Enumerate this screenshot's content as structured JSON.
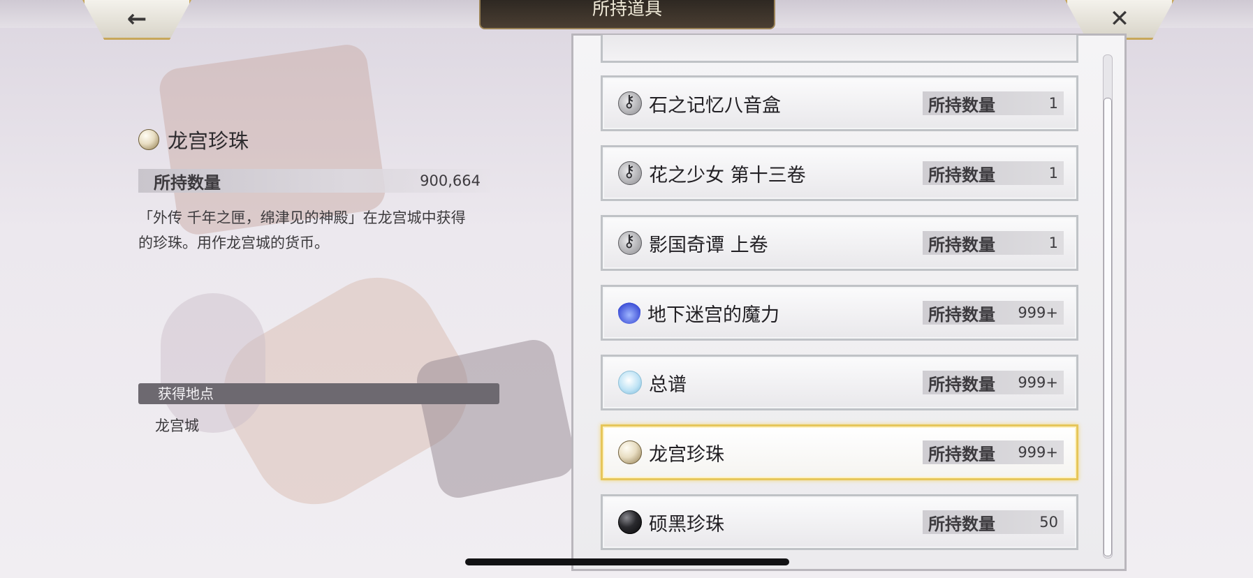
{
  "header": {
    "title": "所持道具",
    "back_icon": "←",
    "close_icon": "✕"
  },
  "detail": {
    "icon": "pearl-icon",
    "name": "龙宫珍珠",
    "qty_label": "所持数量",
    "qty_value": "900,664",
    "description_line1": "「外传 千年之匣，绵津见的神殿」在龙宫城中获得",
    "description_line2": "的珍珠。用作龙宫城的货币。",
    "source_heading": "获得地点",
    "source_value": "龙宫城"
  },
  "items": [
    {
      "icon": "key-icon",
      "name": "石之记忆八音盒",
      "qty_label": "所持数量",
      "qty": "1"
    },
    {
      "icon": "key-icon",
      "name": "花之少女 第十三卷",
      "qty_label": "所持数量",
      "qty": "1"
    },
    {
      "icon": "key-icon",
      "name": "影国奇谭 上卷",
      "qty_label": "所持数量",
      "qty": "1"
    },
    {
      "icon": "flame-icon",
      "name": "地下迷宫的魔力",
      "qty_label": "所持数量",
      "qty": "999+"
    },
    {
      "icon": "frost-icon",
      "name": "总谱",
      "qty_label": "所持数量",
      "qty": "999+"
    },
    {
      "icon": "pearl-icon",
      "name": "龙宫珍珠",
      "qty_label": "所持数量",
      "qty": "999+",
      "selected": true
    },
    {
      "icon": "black-pearl-icon",
      "name": "硕黑珍珠",
      "qty_label": "所持数量",
      "qty": "50"
    }
  ],
  "colors": {
    "selected_border": "#e6c65a",
    "title_plate": "#2e2822"
  }
}
